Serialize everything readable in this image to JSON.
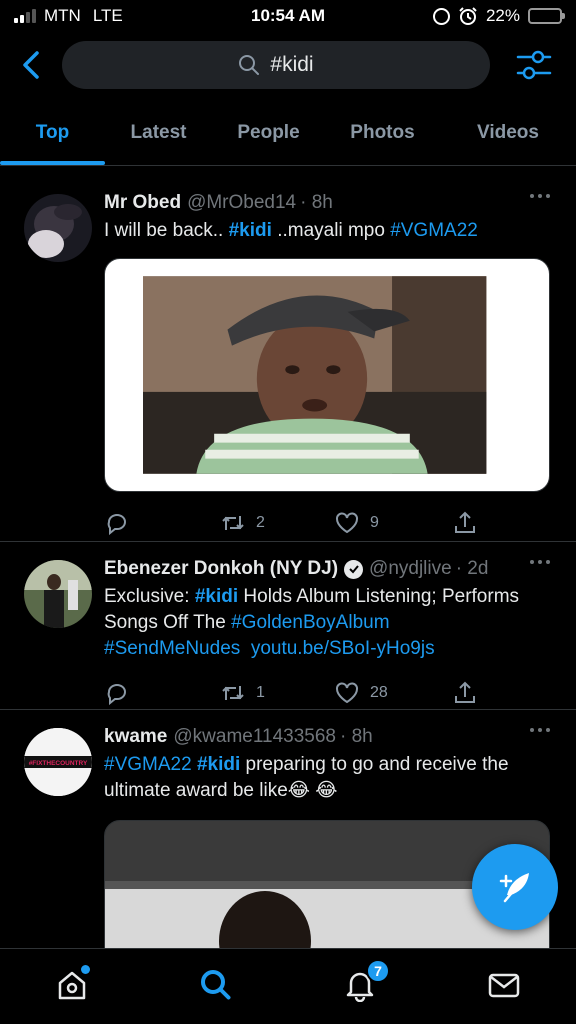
{
  "status_bar": {
    "carrier": "MTN",
    "network": "LTE",
    "time": "10:54 AM",
    "battery": "22%",
    "battery_level": 0.22
  },
  "search": {
    "query": "#kidi"
  },
  "tabs": [
    {
      "label": "Top",
      "active": true
    },
    {
      "label": "Latest"
    },
    {
      "label": "People"
    },
    {
      "label": "Photos"
    },
    {
      "label": "Videos"
    }
  ],
  "tweets": [
    {
      "name": "Mr Obed",
      "handle": "@MrObed14",
      "time": "· 8h",
      "text": [
        "I will be back.. ",
        "#kidi",
        " ..mayali mpo ",
        "#VGMA22"
      ],
      "replies": "",
      "retweets": "2",
      "likes": "9"
    },
    {
      "name": "Ebenezer Donkoh (NY DJ)",
      "verified": true,
      "handle": "@nydjlive",
      "time": "· 2d",
      "text": [
        "Exclusive: ",
        "#kidi",
        " Holds Album Listening; Performs Songs Off The ",
        "#GoldenBoyAlbum",
        "#SendMeNudes",
        "youtu.be/SBoI-yHo9js"
      ],
      "replies": "",
      "retweets": "1",
      "likes": "28"
    },
    {
      "name": "kwame",
      "handle": "@kwame11433568",
      "time": "· 8h",
      "text": [
        "#VGMA22",
        "#kidi",
        " preparing to go and receive the ultimate award be like",
        "😂 😂"
      ],
      "avatar_text": "#FIXTHECOUNTRY"
    }
  ],
  "bottom_nav": {
    "notifications_count": "7"
  },
  "colors": {
    "accent": "#1d9bf0",
    "background": "#000000",
    "muted": "#71767b"
  }
}
